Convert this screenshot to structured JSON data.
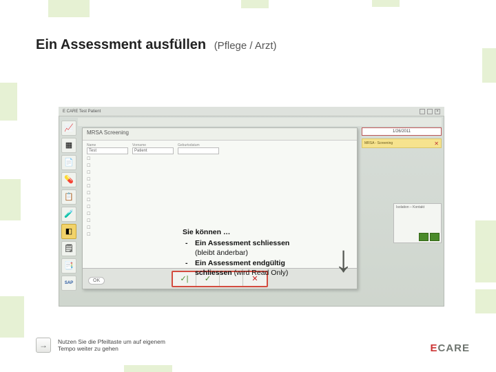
{
  "slide": {
    "title": "Ein Assessment ausfüllen",
    "subtitle": "(Pflege / Arzt)"
  },
  "screenshot": {
    "window_title_left": "E CARE   Test Patient",
    "window_title_right": "",
    "date": "1/26/2011",
    "panel_title": "MRSA Screening",
    "field_name_label": "Name",
    "field_name_value": "Test",
    "field_firstname_label": "Vorname",
    "field_firstname_value": "Patient",
    "field_birth_label": "Geburtsdatum",
    "alert_strip": "MRSA - Screening",
    "ok_label": "OK",
    "side_header": "Isolation – Kontakt"
  },
  "callout": {
    "lead": "Sie können …",
    "item1": "Ein Assessment schliessen",
    "item1_note": "(bleibt änderbar)",
    "item2a": "Ein Assessment endgültig",
    "item2b": "schliessen",
    "item2_note": "(wird Read Only)"
  },
  "hint": {
    "arrow_glyph": "→",
    "text": "Nutzen Sie die Pfeiltaste um auf eigenem Tempo weiter zu gehen"
  },
  "brand": {
    "e": "E",
    "rest": "CARE"
  },
  "icons": {
    "big_arrow": "↓"
  }
}
